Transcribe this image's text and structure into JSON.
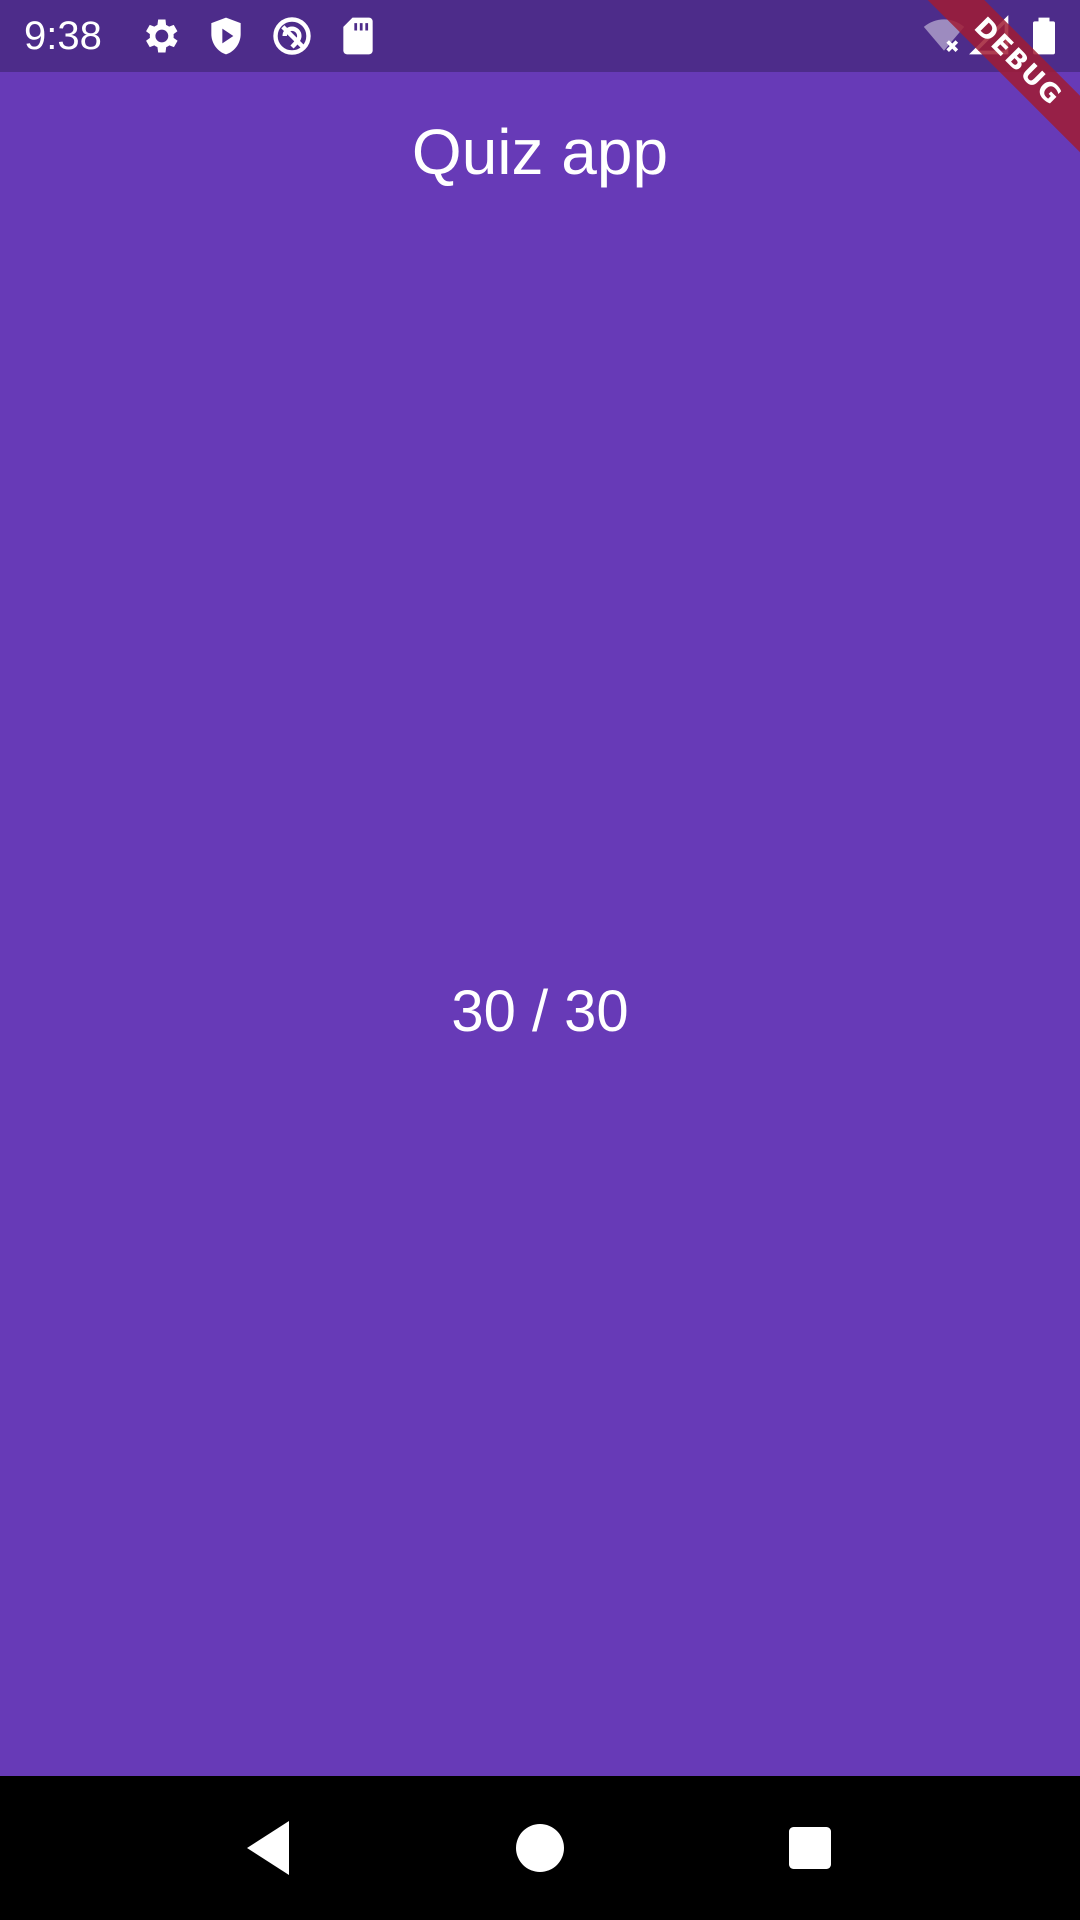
{
  "status_bar": {
    "time": "9:38",
    "icons": [
      "gear-icon",
      "play-shield-icon",
      "no-location-icon",
      "sd-card-icon",
      "wifi-off-icon",
      "signal-icon",
      "battery-icon"
    ]
  },
  "app_bar": {
    "title": "Quiz app"
  },
  "main": {
    "score": "30 / 30"
  },
  "debug_banner": {
    "label": "DEBUG"
  },
  "nav_bar": {
    "buttons": [
      "back-icon",
      "home-icon",
      "recents-icon"
    ]
  },
  "colors": {
    "background": "#673AB7",
    "status_bar": "#4D2C8A",
    "nav_bar": "#000000",
    "text": "#FFFFFF",
    "debug_ribbon": "#A01C34"
  }
}
